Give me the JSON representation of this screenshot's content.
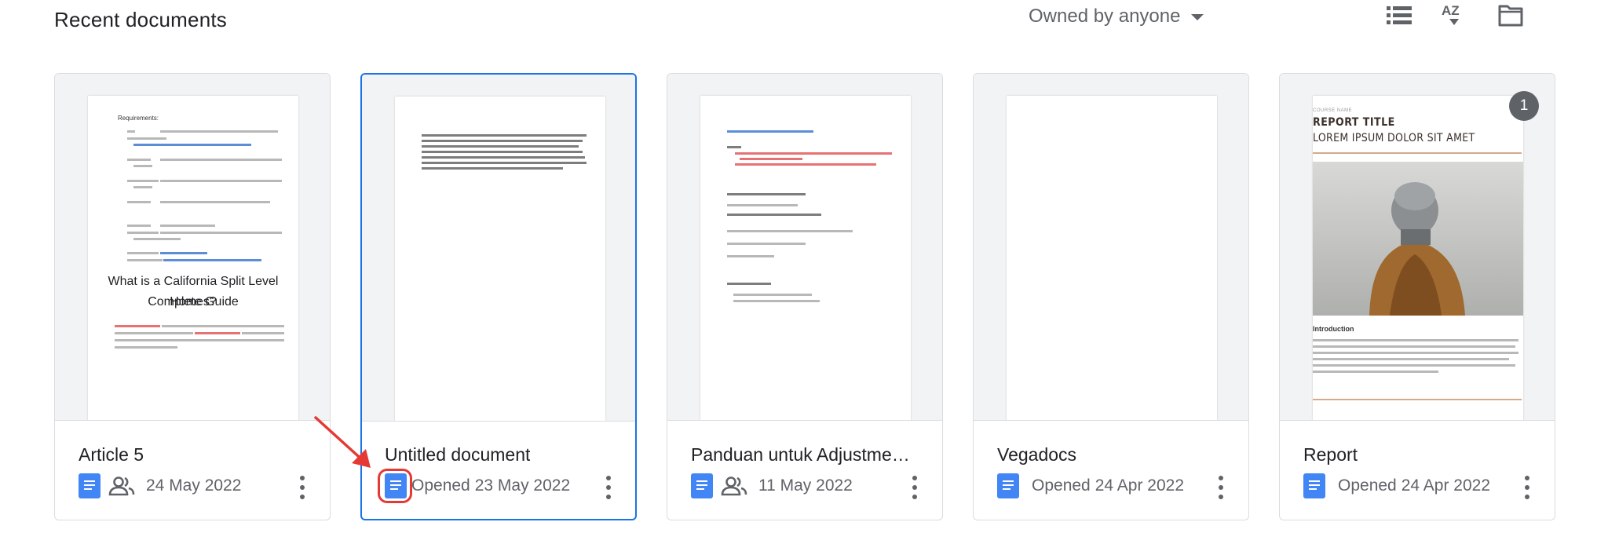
{
  "header": {
    "title": "Recent documents",
    "owner_filter": "Owned by anyone",
    "icons": [
      "list-view-icon",
      "sort-az-icon",
      "folder-icon"
    ],
    "sort_label": "AZ"
  },
  "colors": {
    "selection": "#1a73e8",
    "docs_blue": "#4285f4",
    "highlight": "#e53935",
    "muted": "#5f6368"
  },
  "documents": [
    {
      "title": "Article 5",
      "shared": true,
      "date_prefix": "",
      "date": "24 May 2022",
      "preview": {
        "heading": "Requirements:",
        "fields": [
          {
            "label": "Topic",
            "value": ": What is a California Split Level Homes? Complete Guide"
          },
          {
            "label": "Article references",
            "value": "https://homesteady.com/12686185/what-is-a-california-split-level-home"
          },
          {
            "label": "Main Keyword",
            "value": ": California Split Level Homes (Masukan keyword ini 4x pada artikel)"
          },
          {
            "label": "Secondary Keywords",
            "value": ": California homes for sale (Masukan keyword ini 2x pada artikel)"
          },
          {
            "label": "Third keyword",
            "value": ": realtor California (Masukan keyword ini 1x pada artikel)"
          },
          {
            "label": "Words Count",
            "value": ": words (minimal 500 kata)"
          },
          {
            "label": "Plagiarism Check",
            "value": ": (Plagiasi wajib 0%, cantumkan screenshot plagiasi dari duplichecker dibawah artikel)"
          },
          {
            "label": "Plagiarism Checker",
            "value": ": https://duplichecker.com/"
          },
          {
            "label": "SEO friendly proofread",
            "value": ": https://quest.com/research/real-time-content-analysis"
          }
        ],
        "doc_title_line1": "What is a California Split Level Homes?",
        "doc_title_line2": "Complete Guide",
        "body": "California split level homes is a type of dwelling floor plan distinguished by three levels. This type of floor plan became popular in the 1960s and 1970s. California split level homes are typically seen in the suburbs of the West Coast and can be confused with \"bi-level\" or \"raised ranch\" styles of architecture."
      }
    },
    {
      "title": "Untitled document",
      "shared": false,
      "date_prefix": "Opened",
      "date": "23 May 2022",
      "selected": true,
      "preview": {
        "body": "In the last few years, technology has become more and more important in the real estate business. Now that a lot of real estate business is done on social media platforms, storefronts in neighborhoods are no longer a good way to get leads. Even though many people have been left behind by their brick and mortar ways, some forward thinking women have been able to take over the real estate market in the digital age. Here are 5 women who are at the top of their fields and who you should definitely keep an eye on."
      }
    },
    {
      "title": "Panduan untuk Adjustme…",
      "shared": true,
      "date_prefix": "",
      "date": "11 May 2022",
      "preview": {
        "heading": "Panduan untuk Adjustment/Rewrite Artikel 2022",
        "goals_label": "Goals:",
        "goals": [
          "Menemukan adjustment/rewrite yang diperlukan untuk membuat artikel lama terupdate dengan informasi terbaru.",
          "Menambahkan item rekomendasi hingga berjumlah total 35 item."
        ],
        "assign_label": "Untuk melihat assignment-assignment Anda",
        "assign_text": "Silahkan cek URL file pribadi yang diberikan",
        "steps_label": "Langkah-langkah untuk menyunting artikel di situs",
        "steps": [
          "Akses URL berikut dan gunakan ID dan password yang telah diberikan",
          "URL: admin.bp-guide.id/core/login",
          "Pilih artikel yang akan dikerjakan"
        ],
        "tech_label": "Teknis pengerjaan:",
        "tech": [
          "Setelah memutuskan satu artikel, klik edit.",
          "Anda akan melihat teks teks seperti berikut."
        ]
      }
    },
    {
      "title": "Vegadocs",
      "shared": false,
      "date_prefix": "Opened",
      "date": "24 Apr 2022",
      "preview": {}
    },
    {
      "title": "Report",
      "shared": false,
      "date_prefix": "Opened",
      "date": "24 Apr 2022",
      "badge": "1",
      "preview": {
        "kicker": "COURSE NAME",
        "title": "REPORT TITLE",
        "subtitle": "LOREM IPSUM DOLOR SIT AMET",
        "intro_heading": "Introduction",
        "body": "Lorem ipsum dolor sit amet, consectetuer adipiscing elit, sed diam nonummy nibh euismod tincidunt ut laoreet dolore magna aliquam erat volutpat. Ut wisi enim ad minim veniam, quis nostrud exerci tation ullamcorper suscipit lobortis nisl ut aliquip ex ea commodo consequat. Duis autem vel eum iriure dolor in hendrerit in vulputate velit esse molestie consequat, vel illum dolore eu feugiat nulla facilisis at vero eros et accumsan."
      }
    }
  ]
}
